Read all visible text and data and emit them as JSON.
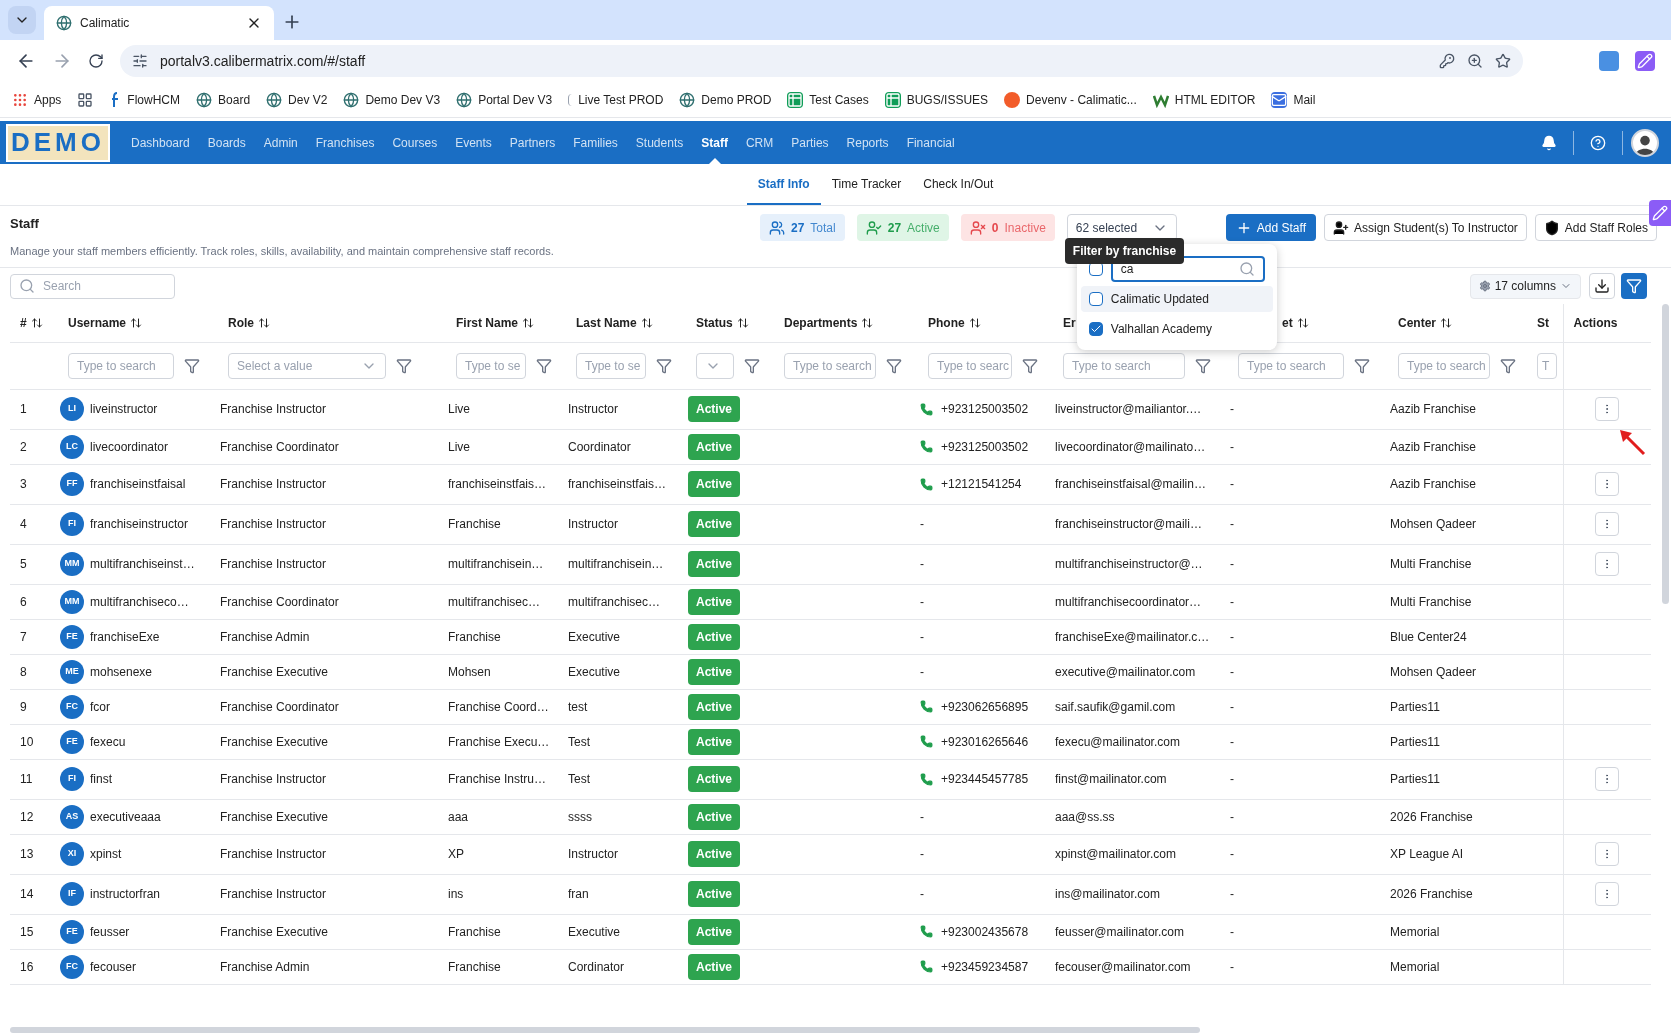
{
  "browser": {
    "tab_title": "Calimatic",
    "url": "portalv3.calibermatrix.com/#/staff",
    "bookmarks": [
      {
        "label": "Apps",
        "kind": "apps"
      },
      {
        "kind": "grid"
      },
      {
        "label": "FlowHCM",
        "kind": "flow"
      },
      {
        "label": "Board",
        "kind": "globe"
      },
      {
        "label": "Dev V2",
        "kind": "globe"
      },
      {
        "label": "Demo Dev V3",
        "kind": "globe"
      },
      {
        "label": "Portal Dev V3",
        "kind": "globe"
      },
      {
        "label": "Live Test PROD",
        "kind": "blank"
      },
      {
        "label": "Demo PROD",
        "kind": "globe"
      },
      {
        "label": "Test Cases",
        "kind": "sheet"
      },
      {
        "label": "BUGS/ISSUES",
        "kind": "sheet"
      },
      {
        "label": "Devenv - Calimatic...",
        "kind": "devenv"
      },
      {
        "label": "HTML EDITOR",
        "kind": "w"
      },
      {
        "label": "Mail",
        "kind": "mail"
      }
    ]
  },
  "app": {
    "logo": "DEMO",
    "nav": [
      {
        "label": "Dashboard",
        "selected": false
      },
      {
        "label": "Boards",
        "selected": false
      },
      {
        "label": "Admin",
        "selected": false
      },
      {
        "label": "Franchises",
        "selected": false
      },
      {
        "label": "Courses",
        "selected": false
      },
      {
        "label": "Events",
        "selected": false
      },
      {
        "label": "Partners",
        "selected": false
      },
      {
        "label": "Families",
        "selected": false
      },
      {
        "label": "Students",
        "selected": false
      },
      {
        "label": "Staff",
        "selected": true
      },
      {
        "label": "CRM",
        "selected": false
      },
      {
        "label": "Parties",
        "selected": false
      },
      {
        "label": "Reports",
        "selected": false
      },
      {
        "label": "Financial",
        "selected": false
      }
    ],
    "subtabs": [
      {
        "label": "Staff Info",
        "selected": true
      },
      {
        "label": "Time Tracker",
        "selected": false
      },
      {
        "label": "Check In/Out",
        "selected": false
      }
    ]
  },
  "page": {
    "title": "Staff",
    "description": "Manage your staff members efficiently. Track roles, skills, availability, and maintain comprehensive staff records.",
    "stats": [
      {
        "kind": "total",
        "count": "27",
        "label": "Total"
      },
      {
        "kind": "active",
        "count": "27",
        "label": "Active"
      },
      {
        "kind": "inactive",
        "count": "0",
        "label": "Inactive"
      }
    ],
    "franchise_select": {
      "value": "62 selected",
      "tooltip": "Filter by franchise",
      "search_value": "ca",
      "select_all_checked": false,
      "options": [
        {
          "label": "Calimatic Updated",
          "checked": false
        },
        {
          "label": "Valhallan Academy",
          "checked": true
        }
      ]
    },
    "buttons": [
      {
        "kind": "primary",
        "label": "Add Staff"
      },
      {
        "kind": "assign",
        "label": "Assign Student(s) To Instructor"
      },
      {
        "kind": "roles",
        "label": "Add Staff Roles"
      }
    ],
    "search": {
      "placeholder": "Search"
    },
    "columns_button": "17 columns"
  },
  "table": {
    "columns": [
      {
        "label": "#",
        "sortable": true,
        "kind": "none"
      },
      {
        "label": "Username",
        "sortable": true,
        "kind": "text",
        "placeholder": "Type to search"
      },
      {
        "label": "Role",
        "sortable": true,
        "kind": "select",
        "placeholder": "Select a value"
      },
      {
        "label": "First Name",
        "sortable": true,
        "kind": "text",
        "placeholder": "Type to se"
      },
      {
        "label": "Last Name",
        "sortable": true,
        "kind": "text",
        "placeholder": "Type to se"
      },
      {
        "label": "Status",
        "sortable": true,
        "kind": "select"
      },
      {
        "label": "Departments",
        "sortable": true,
        "kind": "text",
        "placeholder": "Type to search"
      },
      {
        "label": "Phone",
        "sortable": true,
        "kind": "text",
        "placeholder": "Type to searc"
      },
      {
        "label": "Er",
        "sortable": false,
        "kind": "text",
        "placeholder": "Type to search"
      },
      {
        "label": "et",
        "sortable": true,
        "kind": "text",
        "placeholder": "Type to search"
      },
      {
        "label": "Center",
        "sortable": true,
        "kind": "text",
        "placeholder": "Type to search"
      },
      {
        "label": "St",
        "sortable": false,
        "kind": "text",
        "placeholder": "T"
      },
      {
        "label": "Actions",
        "sortable": false,
        "kind": "none"
      }
    ],
    "rows": [
      {
        "n": "1",
        "initials": "LI",
        "username": "liveinstructor",
        "role": "Franchise Instructor",
        "first": "Live",
        "last": "Instructor",
        "status": "Active",
        "phone": "+923125003502",
        "phone_icon": true,
        "email": "liveinstructor@mailiantor.…",
        "col_10": "-",
        "center": "Aazib Franchise",
        "menu": true
      },
      {
        "n": "2",
        "initials": "LC",
        "username": "livecoordinator",
        "role": "Franchise Coordinator",
        "first": "Live",
        "last": "Coordinator",
        "status": "Active",
        "phone": "+923125003502",
        "phone_icon": true,
        "email": "livecoordinator@mailinato…",
        "col_10": "-",
        "center": "Aazib Franchise",
        "menu": false
      },
      {
        "n": "3",
        "initials": "FF",
        "username": "franchiseinstfaisal",
        "role": "Franchise Instructor",
        "first": "franchiseinstfais…",
        "last": "franchiseinstfais…",
        "status": "Active",
        "phone": "+12121541254",
        "phone_icon": true,
        "email": "franchiseinstfaisal@mailin…",
        "col_10": "-",
        "center": "Aazib Franchise",
        "menu": true
      },
      {
        "n": "4",
        "initials": "FI",
        "username": "franchiseinstructor",
        "role": "Franchise Instructor",
        "first": "Franchise",
        "last": "Instructor",
        "status": "Active",
        "phone": "-",
        "phone_icon": false,
        "email": "franchiseinstructor@maili…",
        "col_10": "-",
        "center": "Mohsen Qadeer",
        "menu": true
      },
      {
        "n": "5",
        "initials": "MM",
        "username": "multifranchiseinst…",
        "role": "Franchise Instructor",
        "first": "multifranchisein…",
        "last": "multifranchisein…",
        "status": "Active",
        "phone": "-",
        "phone_icon": false,
        "email": "multifranchiseinstructor@…",
        "col_10": "-",
        "center": "Multi Franchise",
        "menu": true
      },
      {
        "n": "6",
        "initials": "MM",
        "username": "multifranchiseco…",
        "role": "Franchise Coordinator",
        "first": "multifranchisec…",
        "last": "multifranchisec…",
        "status": "Active",
        "phone": "-",
        "phone_icon": false,
        "email": "multifranchisecoordinator…",
        "col_10": "-",
        "center": "Multi Franchise",
        "menu": false
      },
      {
        "n": "7",
        "initials": "FE",
        "username": "franchiseExe",
        "role": "Franchise Admin",
        "first": "Franchise",
        "last": "Executive",
        "status": "Active",
        "phone": "-",
        "phone_icon": false,
        "email": "franchiseExe@mailinator.c…",
        "col_10": "-",
        "center": "Blue Center24",
        "menu": false
      },
      {
        "n": "8",
        "initials": "ME",
        "username": "mohsenexe",
        "role": "Franchise Executive",
        "first": "Mohsen",
        "last": "Executive",
        "status": "Active",
        "phone": "-",
        "phone_icon": false,
        "email": "executive@mailinator.com",
        "col_10": "-",
        "center": "Mohsen Qadeer",
        "menu": false
      },
      {
        "n": "9",
        "initials": "FC",
        "username": "fcor",
        "role": "Franchise Coordinator",
        "first": "Franchise Coord…",
        "last": "test",
        "status": "Active",
        "phone": "+923062656895",
        "phone_icon": true,
        "email": "saif.saufik@gamil.com",
        "col_10": "-",
        "center": "Parties11",
        "menu": false
      },
      {
        "n": "10",
        "initials": "FE",
        "username": "fexecu",
        "role": "Franchise Executive",
        "first": "Franchise Execu…",
        "last": "Test",
        "status": "Active",
        "phone": "+923016265646",
        "phone_icon": true,
        "email": "fexecu@mailinator.com",
        "col_10": "-",
        "center": "Parties11",
        "menu": false
      },
      {
        "n": "11",
        "initials": "FI",
        "username": "finst",
        "role": "Franchise Instructor",
        "first": "Franchise Instru…",
        "last": "Test",
        "status": "Active",
        "phone": "+923445457785",
        "phone_icon": true,
        "email": "finst@mailinator.com",
        "col_10": "-",
        "center": "Parties11",
        "menu": true
      },
      {
        "n": "12",
        "initials": "AS",
        "username": "executiveaaa",
        "role": "Franchise Executive",
        "first": "aaa",
        "last": "ssss",
        "status": "Active",
        "phone": "-",
        "phone_icon": false,
        "email": "aaa@ss.ss",
        "col_10": "-",
        "center": "2026 Franchise",
        "menu": false
      },
      {
        "n": "13",
        "initials": "XI",
        "username": "xpinst",
        "role": "Franchise Instructor",
        "first": "XP",
        "last": "Instructor",
        "status": "Active",
        "phone": "-",
        "phone_icon": false,
        "email": "xpinst@mailinator.com",
        "col_10": "-",
        "center": "XP League AI",
        "menu": true
      },
      {
        "n": "14",
        "initials": "IF",
        "username": "instructorfran",
        "role": "Franchise Instructor",
        "first": "ins",
        "last": "fran",
        "status": "Active",
        "phone": "-",
        "phone_icon": false,
        "email": "ins@mailinator.com",
        "col_10": "-",
        "center": "2026 Franchise",
        "menu": true
      },
      {
        "n": "15",
        "initials": "FE",
        "username": "feusser",
        "role": "Franchise Executive",
        "first": "Franchise",
        "last": "Executive",
        "status": "Active",
        "phone": "+923002435678",
        "phone_icon": true,
        "email": "feusser@mailinator.com",
        "col_10": "-",
        "center": "Memorial",
        "menu": false
      },
      {
        "n": "16",
        "initials": "FC",
        "username": "fecouser",
        "role": "Franchise Admin",
        "first": "Franchise",
        "last": "Cordinator",
        "status": "Active",
        "phone": "+923459234587",
        "phone_icon": true,
        "email": "fecouser@mailinator.com",
        "col_10": "-",
        "center": "Memorial",
        "menu": false
      }
    ]
  }
}
